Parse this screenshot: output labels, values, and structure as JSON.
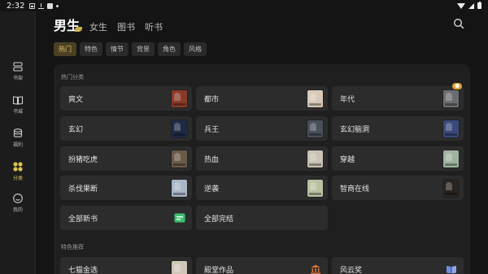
{
  "status_bar": {
    "time": "2:32"
  },
  "sidebar": {
    "items": [
      {
        "label": "书架",
        "icon": "bookshelf-icon",
        "active": false
      },
      {
        "label": "书城",
        "icon": "book-open-icon",
        "active": false
      },
      {
        "label": "福利",
        "icon": "database-icon",
        "active": false
      },
      {
        "label": "分类",
        "icon": "category-grid-icon",
        "active": true
      },
      {
        "label": "我的",
        "icon": "smile-icon",
        "active": false
      }
    ]
  },
  "header": {
    "tabs": [
      {
        "label": "男生",
        "active": true
      },
      {
        "label": "女生",
        "active": false
      },
      {
        "label": "图书",
        "active": false
      },
      {
        "label": "听书",
        "active": false
      }
    ],
    "search_icon": "search-icon"
  },
  "filters": {
    "chips": [
      {
        "label": "热门",
        "active": true
      },
      {
        "label": "特色",
        "active": false
      },
      {
        "label": "情节",
        "active": false
      },
      {
        "label": "背景",
        "active": false
      },
      {
        "label": "角色",
        "active": false
      },
      {
        "label": "风格",
        "active": false
      }
    ]
  },
  "hot": {
    "title": "热门分类",
    "items": [
      {
        "label": "爽文",
        "cover_color": "#8a3a2a"
      },
      {
        "label": "都市",
        "cover_color": "#d8c9b8"
      },
      {
        "label": "年代",
        "cover_color": "#6b6e70",
        "badge": "new"
      },
      {
        "label": "玄幻",
        "cover_color": "#1f2a44"
      },
      {
        "label": "兵王",
        "cover_color": "#4a4f5a"
      },
      {
        "label": "玄幻脑洞",
        "cover_color": "#3a4a7a"
      },
      {
        "label": "扮猪吃虎",
        "cover_color": "#6a5a48"
      },
      {
        "label": "热血",
        "cover_color": "#c9c2b5"
      },
      {
        "label": "穿越",
        "cover_color": "#9fb3a0"
      },
      {
        "label": "杀伐果断",
        "cover_color": "#a9b6c6"
      },
      {
        "label": "逆袭",
        "cover_color": "#b8c2a2"
      },
      {
        "label": "智商在线",
        "cover_color": "#2a2420"
      },
      {
        "label": "全部新书",
        "icon": "new-book-icon",
        "icon_color": "#3fbf73"
      },
      {
        "label": "全部完结"
      }
    ]
  },
  "featured": {
    "title": "特色推荐",
    "items": [
      {
        "label": "七猫金选",
        "cover_color": "#cfc6b8"
      },
      {
        "label": "殿堂作品",
        "icon": "temple-icon",
        "icon_color": "#d9743a"
      },
      {
        "label": "风云奖",
        "icon": "award-book-icon",
        "icon_color": "#6f8fe0"
      }
    ]
  },
  "colors": {
    "background": "#141414",
    "panel": "#1f1f1f",
    "cell": "#2c2c2c",
    "accent": "#e2c766"
  }
}
